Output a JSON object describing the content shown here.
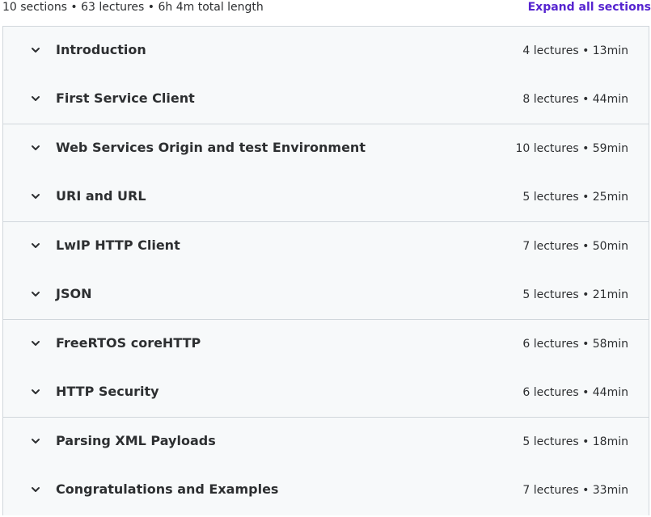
{
  "summary": {
    "text": "10 sections • 63 lectures • 6h 4m total length",
    "expand_label": "Expand all sections"
  },
  "icons": {
    "chevron": "chevron-down-icon"
  },
  "colors": {
    "accent": "#5624d0",
    "row_background": "#f7f9fa",
    "border": "#d1d7dc",
    "text": "#2d2f31"
  },
  "sections": [
    {
      "title": "Introduction",
      "meta": "4 lectures • 13min"
    },
    {
      "title": "First Service Client",
      "meta": "8 lectures • 44min"
    },
    {
      "title": "Web Services Origin and test Environment",
      "meta": "10 lectures • 59min"
    },
    {
      "title": "URI and URL",
      "meta": "5 lectures • 25min"
    },
    {
      "title": "LwIP HTTP Client",
      "meta": "7 lectures • 50min"
    },
    {
      "title": "JSON",
      "meta": "5 lectures • 21min"
    },
    {
      "title": "FreeRTOS coreHTTP",
      "meta": "6 lectures • 58min"
    },
    {
      "title": "HTTP Security",
      "meta": "6 lectures • 44min"
    },
    {
      "title": "Parsing XML Payloads",
      "meta": "5 lectures • 18min"
    },
    {
      "title": "Congratulations and Examples",
      "meta": "7 lectures • 33min"
    }
  ]
}
